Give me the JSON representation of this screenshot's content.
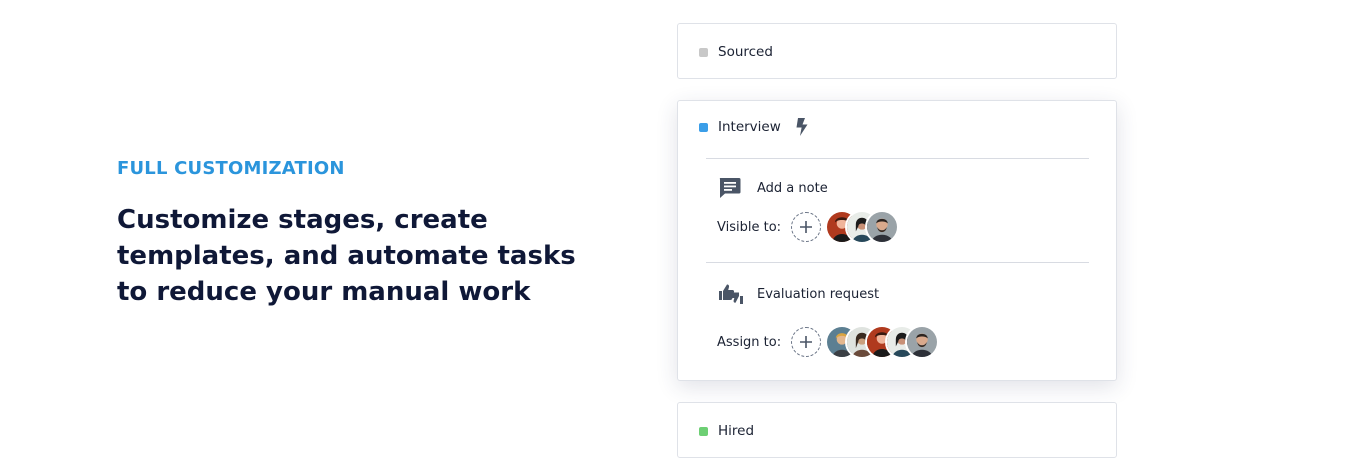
{
  "section": {
    "eyebrow": "FULL CUSTOMIZATION",
    "headline": "Customize stages, create templates, and automate tasks to reduce your manual work"
  },
  "colors": {
    "eyebrow": "#2b95dc",
    "headline": "#0f1837",
    "sourced_dot": "#c8c8c8",
    "interview_dot": "#3b9ee8",
    "hired_dot": "#6dcf74"
  },
  "stages": {
    "sourced": {
      "name": "Sourced",
      "dot_color": "#c8c8c8"
    },
    "interview": {
      "name": "Interview",
      "dot_color": "#3b9ee8",
      "icon": "bolt-icon",
      "actions": [
        {
          "label": "Add a note",
          "icon": "note-icon",
          "assign_label": "Visible to:",
          "avatar_count": 3
        },
        {
          "label": "Evaluation request",
          "icon": "thumbs-icon",
          "assign_label": "Assign to:",
          "avatar_count": 5
        }
      ]
    },
    "hired": {
      "name": "Hired",
      "dot_color": "#6dcf74"
    }
  }
}
